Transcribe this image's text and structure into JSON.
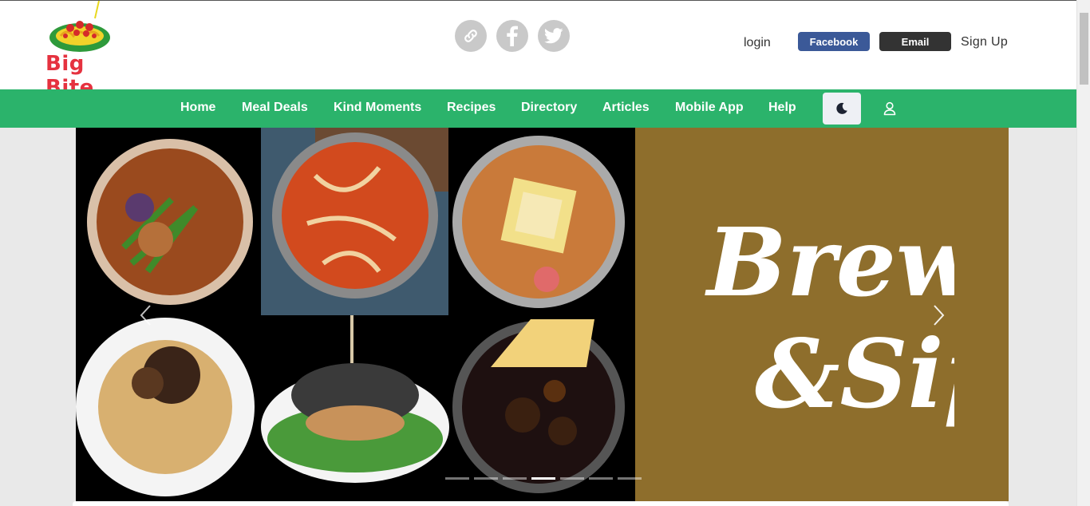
{
  "header": {
    "logo_text": "Big Bite",
    "social_icons": [
      "link-icon",
      "facebook-icon",
      "twitter-icon"
    ],
    "login_label": "login",
    "facebook_label": "Facebook",
    "email_label": "Email",
    "signup_label": "Sign Up"
  },
  "nav": {
    "items": [
      "Home",
      "Meal Deals",
      "Kind Moments",
      "Recipes",
      "Directory",
      "Articles",
      "Mobile App",
      "Help"
    ],
    "theme_icon": "moon-icon",
    "user_icon": "user-icon"
  },
  "hero": {
    "brand_text": "Brew & Sip",
    "slide_count": 7,
    "active_slide": 4
  },
  "colors": {
    "nav_green": "#2bb36b",
    "facebook_blue": "#3b5998",
    "email_dark": "#333333",
    "brand_gold": "#8e6e2c",
    "logo_red": "#e5323f"
  }
}
